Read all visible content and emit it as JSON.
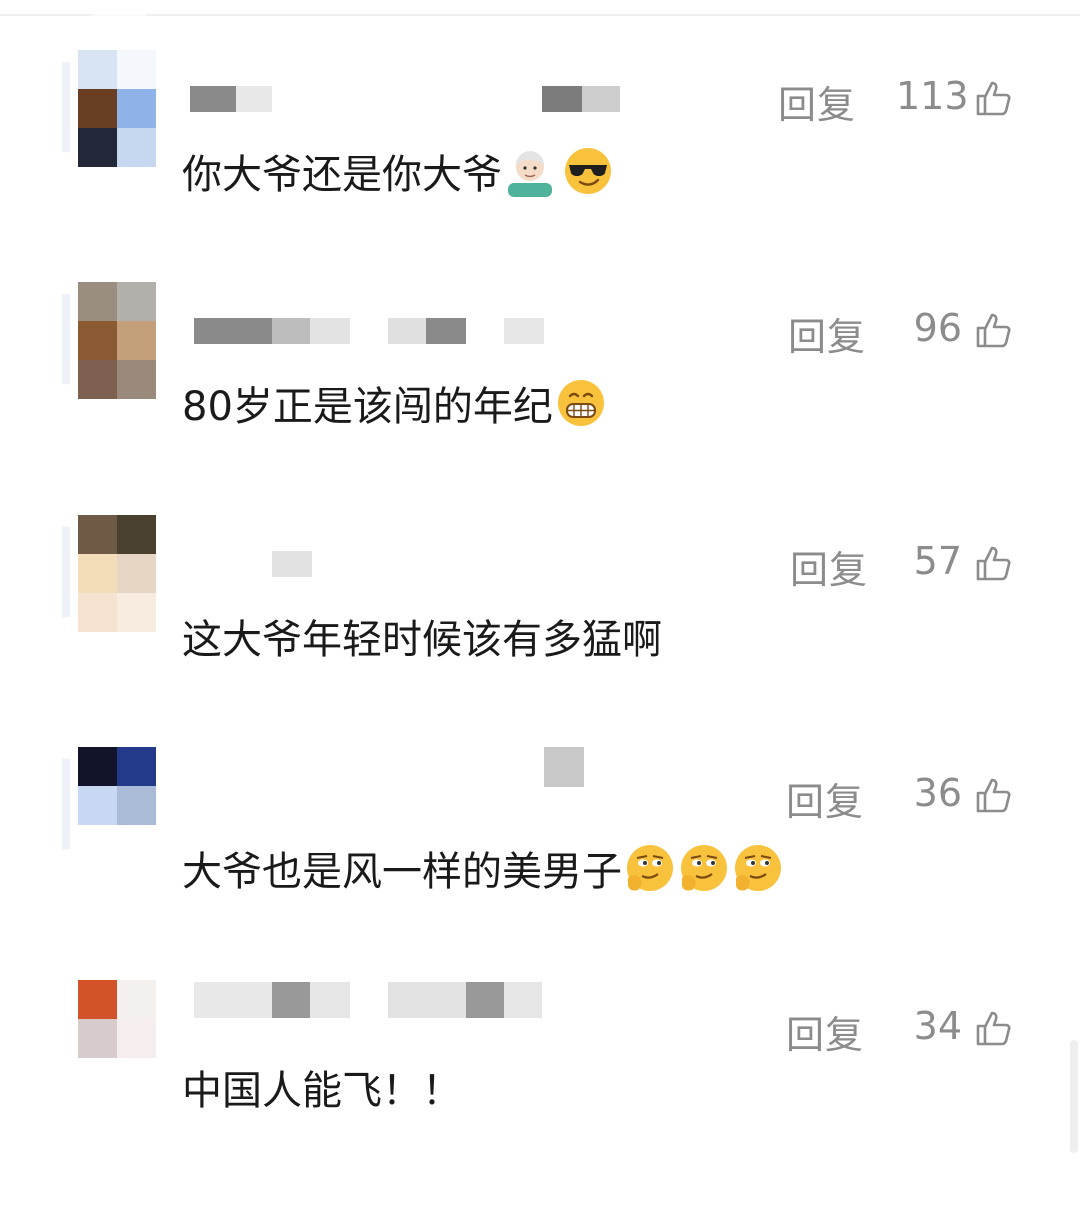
{
  "reply_label": "回复",
  "comments": [
    {
      "text": "你大爷还是你大爷",
      "likes": "113",
      "emojis": [
        "older-man-emoji",
        "sunglasses-face-emoji"
      ]
    },
    {
      "text": "80岁正是该闯的年纪",
      "likes": "96",
      "emojis": [
        "grinning-face-emoji"
      ]
    },
    {
      "text": "这大爷年轻时候该有多猛啊",
      "likes": "57",
      "emojis": []
    },
    {
      "text": "大爷也是风一样的美男子",
      "likes": "36",
      "emojis": [
        "smirk-face-emoji",
        "smirk-face-emoji",
        "smirk-face-emoji"
      ]
    },
    {
      "text": "中国人能飞！！",
      "likes": "34",
      "emojis": []
    }
  ],
  "colors": {
    "text": "#1a1a1a",
    "meta": "#8c8c8c",
    "background": "#ffffff"
  },
  "icons": {
    "like": "thumbs-up-outline-icon"
  }
}
